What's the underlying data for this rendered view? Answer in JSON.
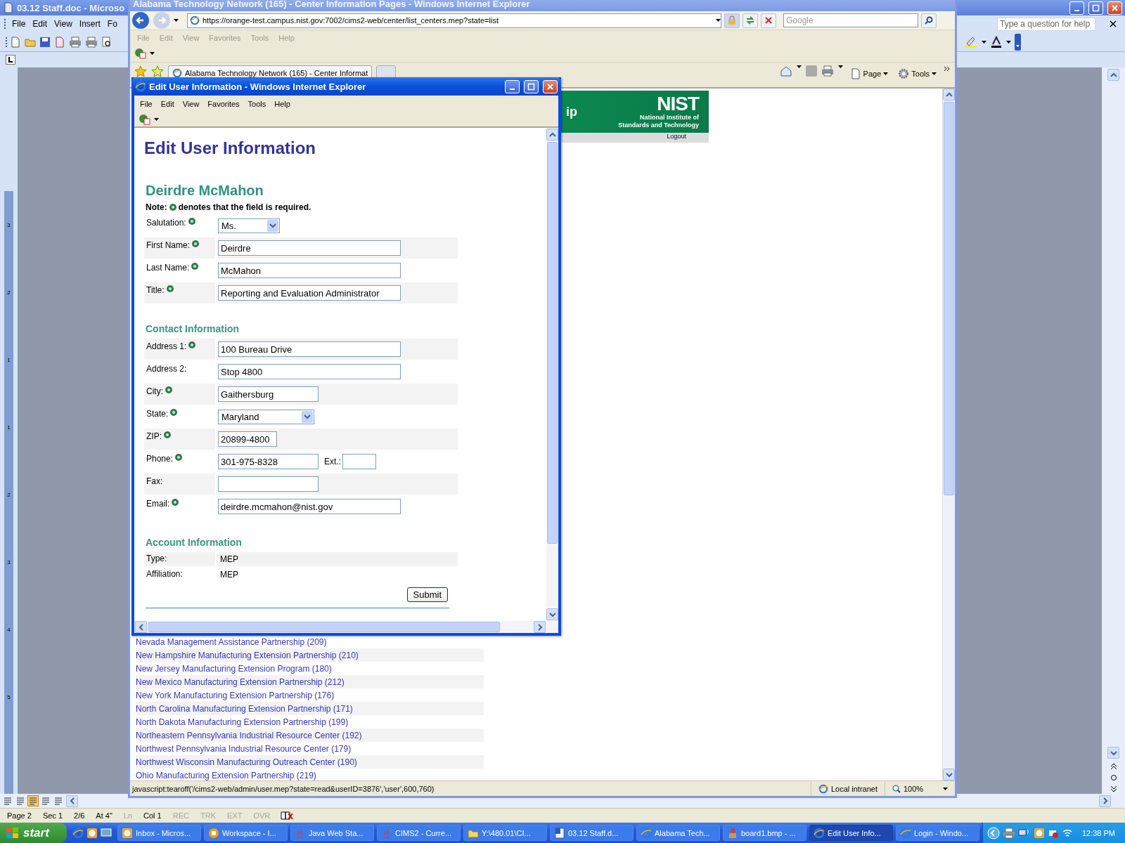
{
  "word": {
    "title": "03.12 Staff.doc - Microso",
    "menu": [
      "File",
      "Edit",
      "View",
      "Insert",
      "Fo"
    ],
    "help_box": {
      "placeholder": "Type a question for help"
    },
    "ruler_numbers": [
      "3",
      "2",
      "1",
      "1",
      "2",
      "3",
      "4",
      "5"
    ],
    "status_bar": [
      {
        "text": "Page 2",
        "disabled": false
      },
      {
        "text": "Sec 1",
        "disabled": false
      },
      {
        "text": "2/6",
        "disabled": false
      },
      {
        "text": "At 4\"",
        "disabled": false
      },
      {
        "text": "Ln",
        "disabled": true
      },
      {
        "text": "Col 1",
        "disabled": false
      },
      {
        "text": "REC",
        "disabled": true
      },
      {
        "text": "TRK",
        "disabled": true
      },
      {
        "text": "EXT",
        "disabled": true
      },
      {
        "text": "OVR",
        "disabled": true
      }
    ]
  },
  "browser": {
    "title": "Alabama Technology Network (165) - Center Information Pages - Windows Internet Explorer",
    "address": "https://orange-test.campus.nist.gov:7002/cims2-web/center/list_centers.mep?state=list",
    "search": {
      "placeholder": "Google"
    },
    "menu": [
      "File",
      "Edit",
      "View",
      "Favorites",
      "Tools",
      "Help"
    ],
    "tab": {
      "label": "Alabama Technology Network (165) - Center Informat"
    },
    "toolbar": [
      "Page",
      "Tools"
    ],
    "banner": {
      "fragment": "ip",
      "logo": "NIST",
      "org": [
        "National Institute of",
        "Standards and Technology"
      ],
      "logout": "Logout"
    },
    "centers": [
      "Nevada Management Assistance Partnership (209)",
      "New Hampshire Manufacturing Extension Partnership (210)",
      "New Jersey Manufacturing Extension Program (180)",
      "New Mexico Manufacturing Extension Partnership (212)",
      "New York Manufacturing Extension Partnership (176)",
      "North Carolina Manufacturing Extension Partnership (171)",
      "North Dakota Manufacturing Extension Partnership (199)",
      "Northeastern Pennsylvania Industrial Resource Center (192)",
      "Northwest Pennsylvania Industrial Resource Center (179)",
      "Northwest Wisconsin Manufacturing Outreach Center (190)",
      "Ohio Manufacturing Extension Partnership (219)"
    ],
    "status": {
      "text": "javascript:tearoff('/cims2-web/admin/user.mep?state=read&userID=3876','user',600,760)",
      "zone": "Local intranet",
      "zoom": "100%"
    }
  },
  "popup": {
    "title": "Edit User Information - Windows Internet Explorer",
    "menu": [
      "File",
      "Edit",
      "View",
      "Favorites",
      "Tools",
      "Help"
    ],
    "heading": "Edit User Information",
    "person": "Deirdre McMahon",
    "note": {
      "label": "Note:",
      "text": "denotes that the field is required."
    },
    "sections": [
      {
        "rows": [
          {
            "label": "Salutation:",
            "required": true,
            "kind": "select",
            "value": "Ms."
          },
          {
            "label": "First Name:",
            "required": true,
            "kind": "text",
            "value": "Deirdre"
          },
          {
            "label": "Last Name:",
            "required": true,
            "kind": "text",
            "value": "McMahon"
          },
          {
            "label": "Title:",
            "required": true,
            "kind": "text",
            "value": "Reporting and Evaluation Administrator"
          }
        ]
      },
      {
        "title": "Contact Information",
        "rows": [
          {
            "label": "Address 1:",
            "required": true,
            "kind": "text",
            "value": "100 Bureau Drive"
          },
          {
            "label": "Address 2:",
            "required": false,
            "kind": "text",
            "value": "Stop 4800"
          },
          {
            "label": "City:",
            "required": true,
            "kind": "text",
            "value": "Gaithersburg"
          },
          {
            "label": "State:",
            "required": true,
            "kind": "select",
            "value": "Maryland"
          },
          {
            "label": "ZIP:",
            "required": true,
            "kind": "text",
            "value": "20899-4800"
          },
          {
            "label": "Phone:",
            "required": true,
            "kind": "text",
            "value": "301-975-8328",
            "ext": {
              "label": "Ext.:"
            }
          },
          {
            "label": "Fax:",
            "required": false,
            "kind": "text"
          },
          {
            "label": "Email:",
            "required": true,
            "kind": "text",
            "value": "deirdre.mcmahon@nist.gov"
          }
        ]
      },
      {
        "title": "Account Information",
        "rows": [
          {
            "label": "Type:",
            "required": false,
            "kind": "static",
            "value": "MEP"
          },
          {
            "label": "Affiliation:",
            "required": false,
            "kind": "static",
            "value": "MEP"
          }
        ]
      }
    ],
    "submit": "Submit"
  },
  "taskbar": {
    "start": "start",
    "tasks": [
      {
        "label": "Inbox - Micros...",
        "kind": "mail",
        "selected": false
      },
      {
        "label": "Workspace - I...",
        "kind": "workspace",
        "selected": false
      },
      {
        "label": "Java Web Sta...",
        "kind": "java",
        "selected": false
      },
      {
        "label": "CIMS2 - Curre...",
        "kind": "java",
        "selected": false
      },
      {
        "label": "Y:\\480.01\\CI...",
        "kind": "folder",
        "selected": false
      },
      {
        "label": "03.12 Staff.d...",
        "kind": "word",
        "selected": false
      },
      {
        "label": "Alabama Tech...",
        "kind": "browser",
        "selected": false
      },
      {
        "label": "board1.bmp - ...",
        "kind": "paint",
        "selected": false
      },
      {
        "label": "Edit User Info...",
        "kind": "browser",
        "selected": true
      },
      {
        "label": "Login - Windo...",
        "kind": "browser",
        "selected": false
      }
    ],
    "clock": "12:38 PM"
  }
}
